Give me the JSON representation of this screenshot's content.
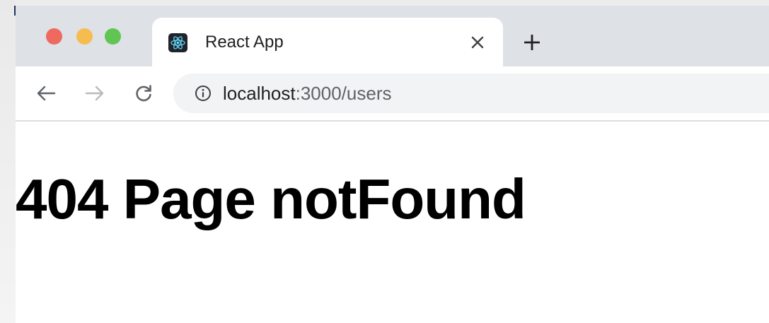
{
  "browser": {
    "tab": {
      "title": "React App",
      "favicon_icon": "react-logo-icon",
      "close_icon": "close-icon"
    },
    "new_tab_icon": "plus-icon",
    "window_controls": [
      "close",
      "minimize",
      "zoom"
    ],
    "navigation": {
      "back_icon": "arrow-left-icon",
      "forward_icon": "arrow-right-icon",
      "reload_icon": "reload-icon"
    },
    "address_bar": {
      "info_icon": "info-icon",
      "host": "localhost",
      "rest": ":3000/users"
    }
  },
  "page": {
    "heading": "404 Page notFound"
  },
  "colors": {
    "tabbar_bg": "#dee1e6",
    "omnibox_bg": "#f1f3f4",
    "traffic_red": "#ee6a5f",
    "traffic_yellow": "#f5bd4f",
    "traffic_green": "#61c554",
    "react_blue": "#61dafb"
  }
}
